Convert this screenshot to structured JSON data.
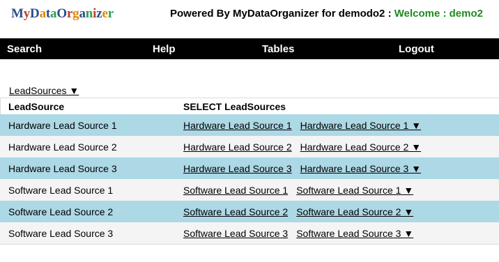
{
  "logo": {
    "letters": [
      {
        "ch": "M",
        "color": "#2b4f8c"
      },
      {
        "ch": "y",
        "color": "#c0392b"
      },
      {
        "ch": "D",
        "color": "#2b4f8c"
      },
      {
        "ch": "a",
        "color": "#e08a00"
      },
      {
        "ch": "t",
        "color": "#2b4f8c"
      },
      {
        "ch": "a",
        "color": "#27a348"
      },
      {
        "ch": "O",
        "color": "#2b4f8c"
      },
      {
        "ch": "r",
        "color": "#c0392b"
      },
      {
        "ch": "g",
        "color": "#e08a00"
      },
      {
        "ch": "a",
        "color": "#2b4f8c"
      },
      {
        "ch": "n",
        "color": "#27a348"
      },
      {
        "ch": "i",
        "color": "#c0392b"
      },
      {
        "ch": "z",
        "color": "#2b4f8c"
      },
      {
        "ch": "e",
        "color": "#e08a00"
      },
      {
        "ch": "r",
        "color": "#27a348"
      }
    ]
  },
  "header": {
    "powered_by": "Powered By MyDataOrganizer for demodo2 : ",
    "welcome": "Welcome : demo2"
  },
  "nav": {
    "search": "Search",
    "help": "Help",
    "tables": "Tables",
    "logout": "Logout"
  },
  "table_selector": "LeadSources ▼",
  "grid": {
    "headers": [
      "LeadSource",
      "SELECT LeadSources"
    ],
    "rows": [
      {
        "value": "Hardware Lead Source 1",
        "link": "Hardware Lead Source 1",
        "menu": "Hardware Lead Source 1 ▼"
      },
      {
        "value": "Hardware Lead Source 2",
        "link": "Hardware Lead Source 2",
        "menu": "Hardware Lead Source 2 ▼"
      },
      {
        "value": "Hardware Lead Source 3",
        "link": "Hardware Lead Source 3",
        "menu": "Hardware Lead Source 3 ▼"
      },
      {
        "value": "Software Lead Source 1",
        "link": "Software Lead Source 1",
        "menu": "Software Lead Source 1 ▼"
      },
      {
        "value": "Software Lead Source 2",
        "link": "Software Lead Source 2",
        "menu": "Software Lead Source 2 ▼"
      },
      {
        "value": "Software Lead Source 3",
        "link": "Software Lead Source 3",
        "menu": "Software Lead Source 3 ▼"
      }
    ]
  },
  "colors": {
    "nav_background": "#000000",
    "row_highlight": "#add8e6",
    "row_alternate": "#f4f4f4",
    "welcome_text": "#1f8a1f"
  }
}
